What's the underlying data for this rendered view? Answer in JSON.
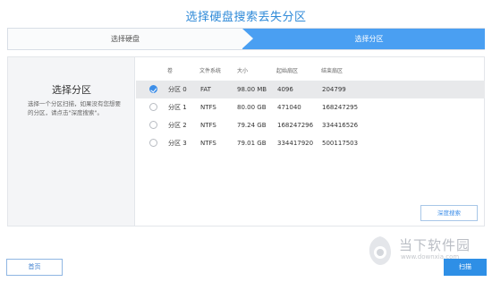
{
  "title": "选择硬盘搜索丢失分区",
  "steps": [
    {
      "label": "选择硬盘",
      "active": false
    },
    {
      "label": "选择分区",
      "active": true
    }
  ],
  "left_panel": {
    "title": "选择分区",
    "description": "选择一个分区扫描，如果没有您想要的分区，请点击\"深度搜索\"。"
  },
  "table": {
    "headers": [
      "卷",
      "文件系统",
      "大小",
      "起始扇区",
      "结束扇区"
    ],
    "rows": [
      {
        "name": "分区 0",
        "fs": "FAT",
        "size": "98.00 MB",
        "start": "4096",
        "end": "204799",
        "selected": true
      },
      {
        "name": "分区 1",
        "fs": "NTFS",
        "size": "80.00 GB",
        "start": "471040",
        "end": "168247295",
        "selected": false
      },
      {
        "name": "分区 2",
        "fs": "NTFS",
        "size": "79.24 GB",
        "start": "168247296",
        "end": "334416526",
        "selected": false
      },
      {
        "name": "分区 3",
        "fs": "NTFS",
        "size": "79.01 GB",
        "start": "334417920",
        "end": "500117503",
        "selected": false
      }
    ]
  },
  "buttons": {
    "deep_search": "深度搜索",
    "home": "首页",
    "scan": "扫描"
  },
  "watermark": {
    "text": "当下软件园",
    "url": "www.downxia.com"
  },
  "colors": {
    "accent": "#2e8fe6",
    "title": "#2f8ad8",
    "active_step": "#4a9ff2"
  }
}
